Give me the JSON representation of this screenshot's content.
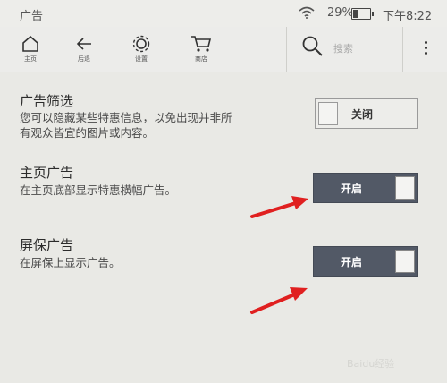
{
  "status_bar": {
    "title": "广告",
    "battery_percent": "29%",
    "battery_level": 0.29,
    "time": "下午8:22"
  },
  "toolbar": {
    "home_label": "主页",
    "back_label": "后退",
    "settings_label": "设置",
    "store_label": "商店",
    "search_placeholder": "搜索"
  },
  "settings": {
    "ad_filter": {
      "title": "广告筛选",
      "desc_line1": "您可以隐藏某些特惠信息，以免出现并非所",
      "desc_line2": "有观众皆宜的图片或内容。",
      "toggle_label": "关闭",
      "state": "off"
    },
    "home_ads": {
      "title": "主页广告",
      "desc": "在主页底部显示特惠横幅广告。",
      "toggle_label": "开启",
      "state": "on"
    },
    "screensaver_ads": {
      "title": "屏保广告",
      "desc": "在屏保上显示广告。",
      "toggle_label": "开启",
      "state": "on"
    }
  },
  "annotation_color": "#e02020",
  "watermark": "Baidu经验"
}
